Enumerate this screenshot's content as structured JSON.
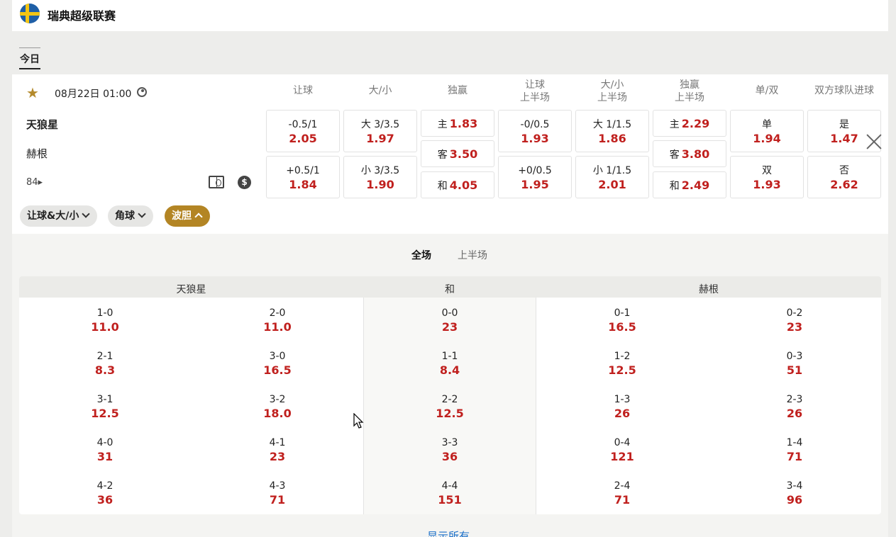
{
  "league": {
    "name": "瑞典超级联赛"
  },
  "tabs": {
    "today": "今日"
  },
  "match": {
    "time": "08月22日 01:00",
    "home": "天狼星",
    "away": "赫根",
    "more_count": "84",
    "more_arrow": "▸",
    "coin_symbol": "$",
    "columns": [
      {
        "line1": "让球",
        "line2": ""
      },
      {
        "line1": "大/小",
        "line2": ""
      },
      {
        "line1": "独赢",
        "line2": ""
      },
      {
        "line1": "让球",
        "line2": "上半场"
      },
      {
        "line1": "大/小",
        "line2": "上半场"
      },
      {
        "line1": "独赢",
        "line2": "上半场"
      },
      {
        "line1": "单/双",
        "line2": ""
      },
      {
        "line1": "双方球队进球",
        "line2": ""
      }
    ],
    "handicap": [
      {
        "label": "-0.5/1",
        "odd": "2.05"
      },
      {
        "label": "+0.5/1",
        "odd": "1.84"
      }
    ],
    "overunder": [
      {
        "label": "大 3/3.5",
        "odd": "1.97"
      },
      {
        "label": "小 3/3.5",
        "odd": "1.90"
      }
    ],
    "moneyline": [
      {
        "label": "主",
        "odd": "1.83"
      },
      {
        "label": "客",
        "odd": "3.50"
      },
      {
        "label": "和",
        "odd": "4.05"
      }
    ],
    "handicap_half": [
      {
        "label": "-0/0.5",
        "odd": "1.93"
      },
      {
        "label": "+0/0.5",
        "odd": "1.95"
      }
    ],
    "overunder_half": [
      {
        "label": "大 1/1.5",
        "odd": "1.86"
      },
      {
        "label": "小 1/1.5",
        "odd": "2.01"
      }
    ],
    "moneyline_half": [
      {
        "label": "主",
        "odd": "2.29"
      },
      {
        "label": "客",
        "odd": "3.80"
      },
      {
        "label": "和",
        "odd": "2.49"
      }
    ],
    "oddeven": [
      {
        "label": "单",
        "odd": "1.94"
      },
      {
        "label": "双",
        "odd": "1.93"
      }
    ],
    "btts": [
      {
        "label": "是",
        "odd": "1.47"
      },
      {
        "label": "否",
        "odd": "2.62"
      }
    ]
  },
  "bet_tabs": [
    {
      "label": "让球&大/小"
    },
    {
      "label": "角球"
    },
    {
      "label": "波胆"
    }
  ],
  "period_tabs": {
    "full": "全场",
    "half": "上半场"
  },
  "correct_score": {
    "headers": {
      "home": "天狼星",
      "draw": "和",
      "away": "赫根"
    },
    "home_a": [
      {
        "score": "1-0",
        "odd": "11.0"
      },
      {
        "score": "2-1",
        "odd": "8.3"
      },
      {
        "score": "3-1",
        "odd": "12.5"
      },
      {
        "score": "4-0",
        "odd": "31"
      },
      {
        "score": "4-2",
        "odd": "36"
      }
    ],
    "home_b": [
      {
        "score": "2-0",
        "odd": "11.0"
      },
      {
        "score": "3-0",
        "odd": "16.5"
      },
      {
        "score": "3-2",
        "odd": "18.0"
      },
      {
        "score": "4-1",
        "odd": "23"
      },
      {
        "score": "4-3",
        "odd": "71"
      }
    ],
    "draw": [
      {
        "score": "0-0",
        "odd": "23"
      },
      {
        "score": "1-1",
        "odd": "8.4"
      },
      {
        "score": "2-2",
        "odd": "12.5"
      },
      {
        "score": "3-3",
        "odd": "36"
      },
      {
        "score": "4-4",
        "odd": "151"
      }
    ],
    "away_a": [
      {
        "score": "0-1",
        "odd": "16.5"
      },
      {
        "score": "1-2",
        "odd": "12.5"
      },
      {
        "score": "1-3",
        "odd": "26"
      },
      {
        "score": "0-4",
        "odd": "121"
      },
      {
        "score": "2-4",
        "odd": "71"
      }
    ],
    "away_b": [
      {
        "score": "0-2",
        "odd": "23"
      },
      {
        "score": "0-3",
        "odd": "51"
      },
      {
        "score": "2-3",
        "odd": "26"
      },
      {
        "score": "1-4",
        "odd": "71"
      },
      {
        "score": "3-4",
        "odd": "96"
      }
    ]
  },
  "show_all": "显示所有",
  "colors": {
    "accent": "#b38524",
    "odd": "#c0201e",
    "link": "#1a6fc9"
  }
}
